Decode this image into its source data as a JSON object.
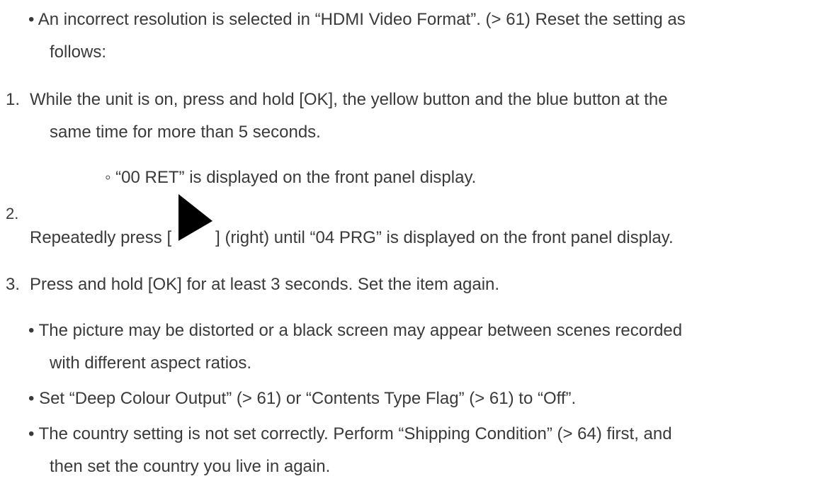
{
  "items": {
    "b1_line1": "• An incorrect resolution is selected in “HDMI Video Format”. (> 61) Reset the setting as",
    "b1_line2": "follows:",
    "s1_num": "1.",
    "s1_line1": "While the unit is on, press and hold [OK], the yellow button and the blue button at the",
    "s1_line2": "same time for more than 5 seconds.",
    "s1_sub": "◦ “00 RET” is displayed on the front panel display.",
    "s2_num": "2.",
    "s2_pre": "Repeatedly press [",
    "s2_post": "] (right) until “04 PRG” is displayed on the front panel display.",
    "s2_icon": "play-icon",
    "s3_num": "3.",
    "s3_line": "Press and hold [OK] for at least 3 seconds. Set the item again.",
    "b2_line1": "• The picture may be distorted or a black screen may appear between scenes recorded",
    "b2_line2": "with different aspect ratios.",
    "b3_line": "• Set “Deep Colour Output” (> 61) or “Contents Type Flag” (> 61) to “Off”.",
    "b4_line1": "• The country setting is not set correctly. Perform “Shipping Condition” (> 64) first, and",
    "b4_line2": "then set the country you live in again."
  },
  "colors": {
    "text": "#3a3a3a",
    "background": "#ffffff",
    "icon": "#000000"
  }
}
